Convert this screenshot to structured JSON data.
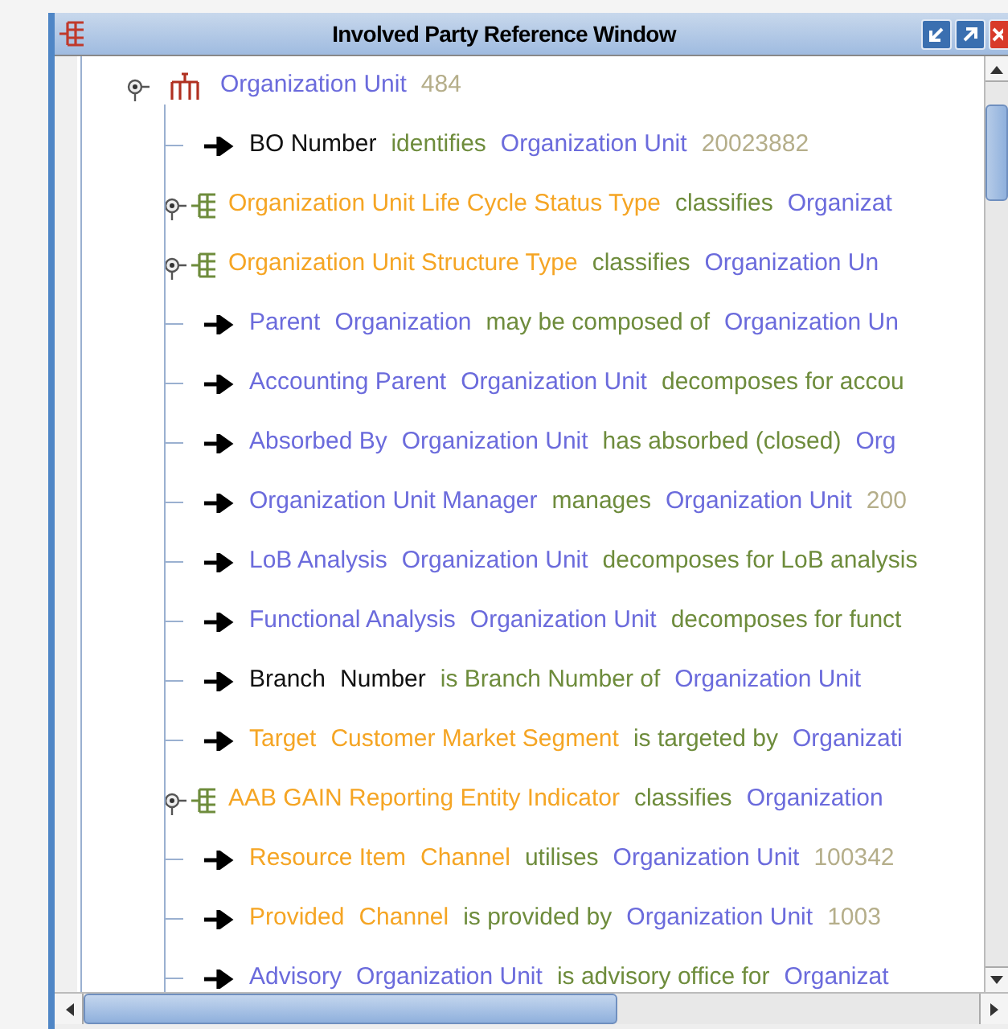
{
  "window": {
    "title": "Involved Party Reference Window"
  },
  "root": {
    "segments": [
      {
        "text": "Organization Unit",
        "color": "#6b6bdc"
      },
      {
        "text": "484",
        "color": "#b5ae8a"
      }
    ]
  },
  "rows": [
    {
      "kind": "relation",
      "segments": [
        {
          "text": "BO Number",
          "color": "#111111"
        },
        {
          "text": "identifies",
          "color": "#6e8c3c"
        },
        {
          "text": "Organization Unit",
          "color": "#6b6bdc"
        },
        {
          "text": "20023882",
          "color": "#b5ae8a"
        }
      ]
    },
    {
      "kind": "classification",
      "segments": [
        {
          "text": "Organization Unit Life Cycle Status Type",
          "color": "#f5a524"
        },
        {
          "text": "classifies",
          "color": "#6e8c3c"
        },
        {
          "text": "Organizat",
          "color": "#6b6bdc"
        }
      ]
    },
    {
      "kind": "classification",
      "segments": [
        {
          "text": "Organization Unit Structure Type",
          "color": "#f5a524"
        },
        {
          "text": "classifies",
          "color": "#6e8c3c"
        },
        {
          "text": "Organization Un",
          "color": "#6b6bdc"
        }
      ]
    },
    {
      "kind": "relation",
      "segments": [
        {
          "text": "Parent",
          "color": "#6b6bdc"
        },
        {
          "text": "Organization",
          "color": "#6b6bdc"
        },
        {
          "text": "may be composed of",
          "color": "#6e8c3c"
        },
        {
          "text": "Organization Un",
          "color": "#6b6bdc"
        }
      ]
    },
    {
      "kind": "relation",
      "segments": [
        {
          "text": "Accounting Parent",
          "color": "#6b6bdc"
        },
        {
          "text": "Organization Unit",
          "color": "#6b6bdc"
        },
        {
          "text": "decomposes for accou",
          "color": "#6e8c3c"
        }
      ]
    },
    {
      "kind": "relation",
      "segments": [
        {
          "text": "Absorbed By",
          "color": "#6b6bdc"
        },
        {
          "text": "Organization Unit",
          "color": "#6b6bdc"
        },
        {
          "text": "has absorbed (closed)",
          "color": "#6e8c3c"
        },
        {
          "text": "Org",
          "color": "#6b6bdc"
        }
      ]
    },
    {
      "kind": "relation",
      "segments": [
        {
          "text": "Organization Unit Manager",
          "color": "#6b6bdc"
        },
        {
          "text": "manages",
          "color": "#6e8c3c"
        },
        {
          "text": "Organization Unit",
          "color": "#6b6bdc"
        },
        {
          "text": "200",
          "color": "#b5ae8a"
        }
      ]
    },
    {
      "kind": "relation",
      "segments": [
        {
          "text": "LoB Analysis",
          "color": "#6b6bdc"
        },
        {
          "text": "Organization Unit",
          "color": "#6b6bdc"
        },
        {
          "text": "decomposes for LoB analysis",
          "color": "#6e8c3c"
        }
      ]
    },
    {
      "kind": "relation",
      "segments": [
        {
          "text": "Functional Analysis",
          "color": "#6b6bdc"
        },
        {
          "text": "Organization Unit",
          "color": "#6b6bdc"
        },
        {
          "text": "decomposes for funct",
          "color": "#6e8c3c"
        }
      ]
    },
    {
      "kind": "relation",
      "segments": [
        {
          "text": "Branch",
          "color": "#111111"
        },
        {
          "text": "Number",
          "color": "#111111"
        },
        {
          "text": "is Branch Number of",
          "color": "#6e8c3c"
        },
        {
          "text": "Organization Unit",
          "color": "#6b6bdc"
        }
      ]
    },
    {
      "kind": "relation",
      "segments": [
        {
          "text": "Target",
          "color": "#f5a524"
        },
        {
          "text": "Customer Market Segment",
          "color": "#f5a524"
        },
        {
          "text": "is targeted by",
          "color": "#6e8c3c"
        },
        {
          "text": "Organizati",
          "color": "#6b6bdc"
        }
      ]
    },
    {
      "kind": "classification",
      "segments": [
        {
          "text": "AAB GAIN Reporting Entity Indicator",
          "color": "#f5a524"
        },
        {
          "text": "classifies",
          "color": "#6e8c3c"
        },
        {
          "text": "Organization",
          "color": "#6b6bdc"
        }
      ]
    },
    {
      "kind": "relation",
      "segments": [
        {
          "text": "Resource Item",
          "color": "#f5a524"
        },
        {
          "text": "Channel",
          "color": "#f5a524"
        },
        {
          "text": "utilises",
          "color": "#6e8c3c"
        },
        {
          "text": "Organization Unit",
          "color": "#6b6bdc"
        },
        {
          "text": "100342",
          "color": "#b5ae8a"
        }
      ]
    },
    {
      "kind": "relation",
      "segments": [
        {
          "text": "Provided",
          "color": "#f5a524"
        },
        {
          "text": "Channel",
          "color": "#f5a524"
        },
        {
          "text": "is provided by",
          "color": "#6e8c3c"
        },
        {
          "text": "Organization Unit",
          "color": "#6b6bdc"
        },
        {
          "text": "1003",
          "color": "#b5ae8a"
        }
      ]
    },
    {
      "kind": "relation",
      "segments": [
        {
          "text": "Advisory",
          "color": "#6b6bdc"
        },
        {
          "text": "Organization Unit",
          "color": "#6b6bdc"
        },
        {
          "text": "is advisory office for",
          "color": "#6e8c3c"
        },
        {
          "text": "Organizat",
          "color": "#6b6bdc"
        }
      ]
    }
  ]
}
